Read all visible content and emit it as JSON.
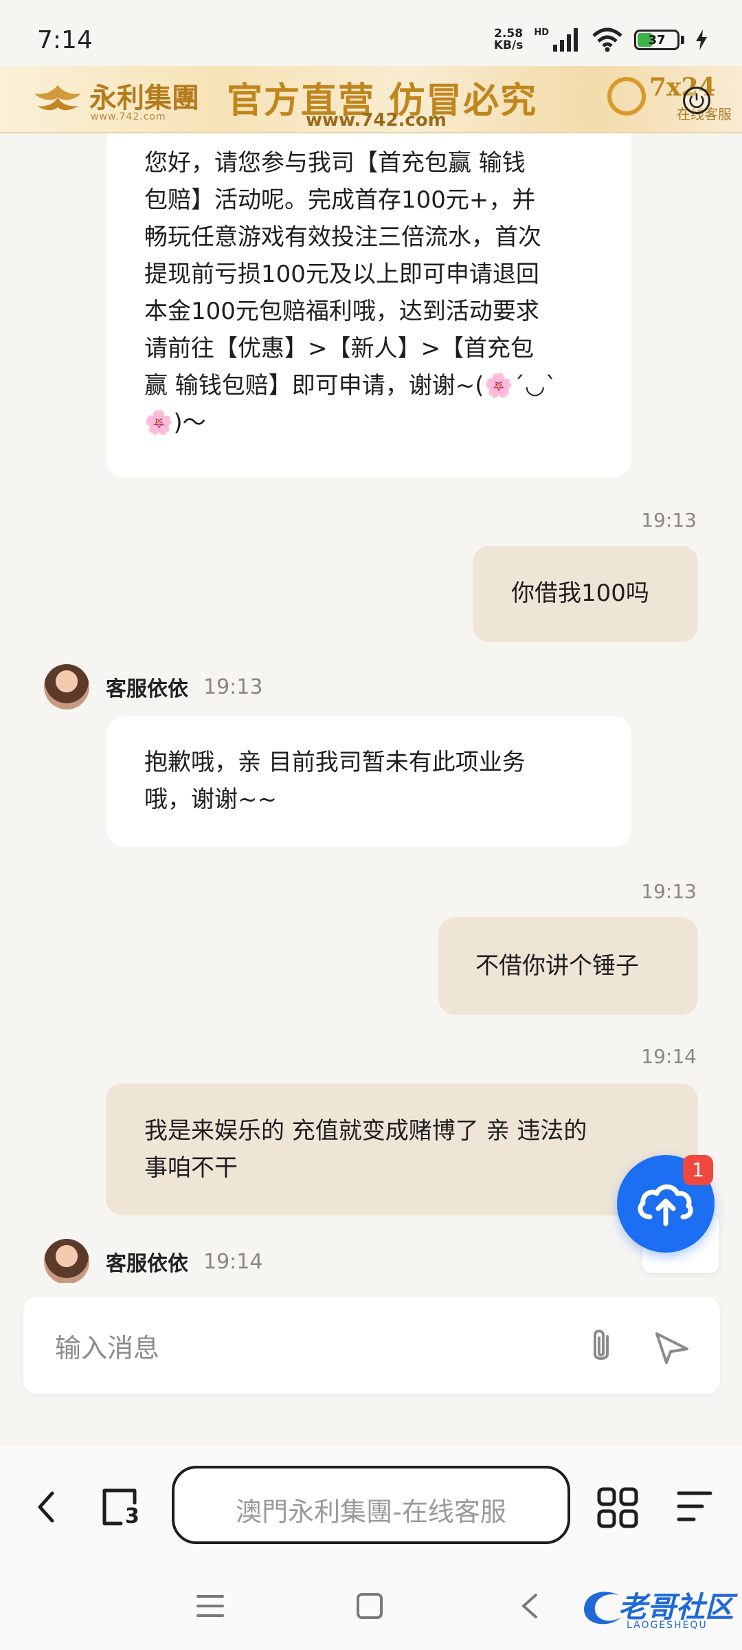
{
  "status_bar": {
    "time": "7:14",
    "net_speed_value": "2.58",
    "net_speed_unit": "KB/s",
    "hd": "HD",
    "battery": "37",
    "battery_level": 0.37
  },
  "banner": {
    "brand": "永利集團",
    "brand_sub": "www.742.com",
    "slogan": "官方直营  仿冒必究",
    "url": "www.742.com",
    "hours": "7x24",
    "online": "在线客服"
  },
  "chat": {
    "messages": [
      {
        "from": "agent",
        "lines": [
          "您好，请您参与我司【首充包赢 输钱",
          "包赔】活动呢。完成首存100元+，并",
          "畅玩任意游戏有效投注三倍流水，首次",
          "提现前亏损100元及以上即可申请退回",
          "本金100元包赔福利哦，达到活动要求",
          "请前往【优惠】>【新人】>【首充包",
          "赢 输钱包赔】即可申请，谢谢~(🌸´◡`",
          "🌸)～"
        ]
      },
      {
        "from": "user",
        "time": "19:13",
        "text": "你借我100吗"
      },
      {
        "from": "agent",
        "name": "客服依依",
        "time": "19:13",
        "lines": [
          "抱歉哦，亲 目前我司暂未有此项业务",
          "哦，谢谢~~"
        ]
      },
      {
        "from": "user",
        "time": "19:13",
        "text": "不借你讲个锤子"
      },
      {
        "from": "user",
        "time": "19:14",
        "lines": [
          "我是来娱乐的 充值就变成赌博了 亲 违法的",
          "事咱不干"
        ]
      },
      {
        "from": "agent",
        "name": "客服依依",
        "time": "19:14"
      }
    ],
    "upload_badge": "1"
  },
  "composer": {
    "placeholder": "输入消息"
  },
  "browser": {
    "url_title": "澳門永利集團-在线客服",
    "tab_count": "3"
  },
  "watermark": {
    "text": "老哥社区",
    "sub": "LAOGESHEQU"
  },
  "colors": {
    "page_bg": "#f7f5f2",
    "agent_bubble": "#ffffff",
    "user_bubble": "#efe5d7",
    "fab_blue": "#1c6ef2",
    "badge_red": "#f0483e",
    "banner_gold": "#c0861e"
  }
}
